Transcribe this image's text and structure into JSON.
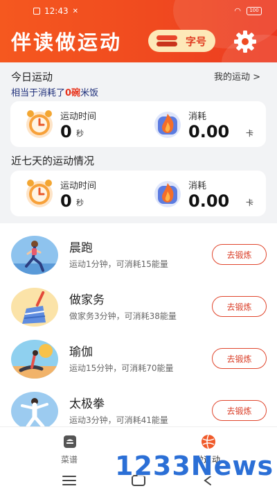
{
  "status_bar": {
    "time": "12:43",
    "battery": "100"
  },
  "header": {
    "title": "伴读做运动",
    "font_button": "字号"
  },
  "today": {
    "title": "今日运动",
    "link": "我的运动 >",
    "summary_prefix": "相当于消耗了",
    "summary_count": "0碗",
    "summary_suffix": "米饭",
    "duration_label": "运动时间",
    "duration_value": "0",
    "duration_unit": "秒",
    "calorie_label": "消耗",
    "calorie_value": "0.00",
    "calorie_unit": "卡"
  },
  "week": {
    "title": "近七天的运动情况",
    "duration_label": "运动时间",
    "duration_value": "0",
    "duration_unit": "秒",
    "calorie_label": "消耗",
    "calorie_value": "0.00",
    "calorie_unit": "卡"
  },
  "exercises": [
    {
      "name": "晨跑",
      "desc": "运动1分钟，可消耗15能量",
      "button": "去锻炼"
    },
    {
      "name": "做家务",
      "desc": "做家务3分钟，可消耗38能量",
      "button": "去锻炼"
    },
    {
      "name": "瑜伽",
      "desc": "运动15分钟，可消耗70能量",
      "button": "去锻炼"
    },
    {
      "name": "太极拳",
      "desc": "运动3分钟，可消耗41能量",
      "button": "去锻炼"
    }
  ],
  "tabs": [
    {
      "label": "菜谱"
    },
    {
      "label": "做运动"
    }
  ],
  "watermark": "1233News",
  "colors": {
    "accent": "#ec4a22",
    "button_border": "#e0452c",
    "highlight": "#e8331c"
  }
}
